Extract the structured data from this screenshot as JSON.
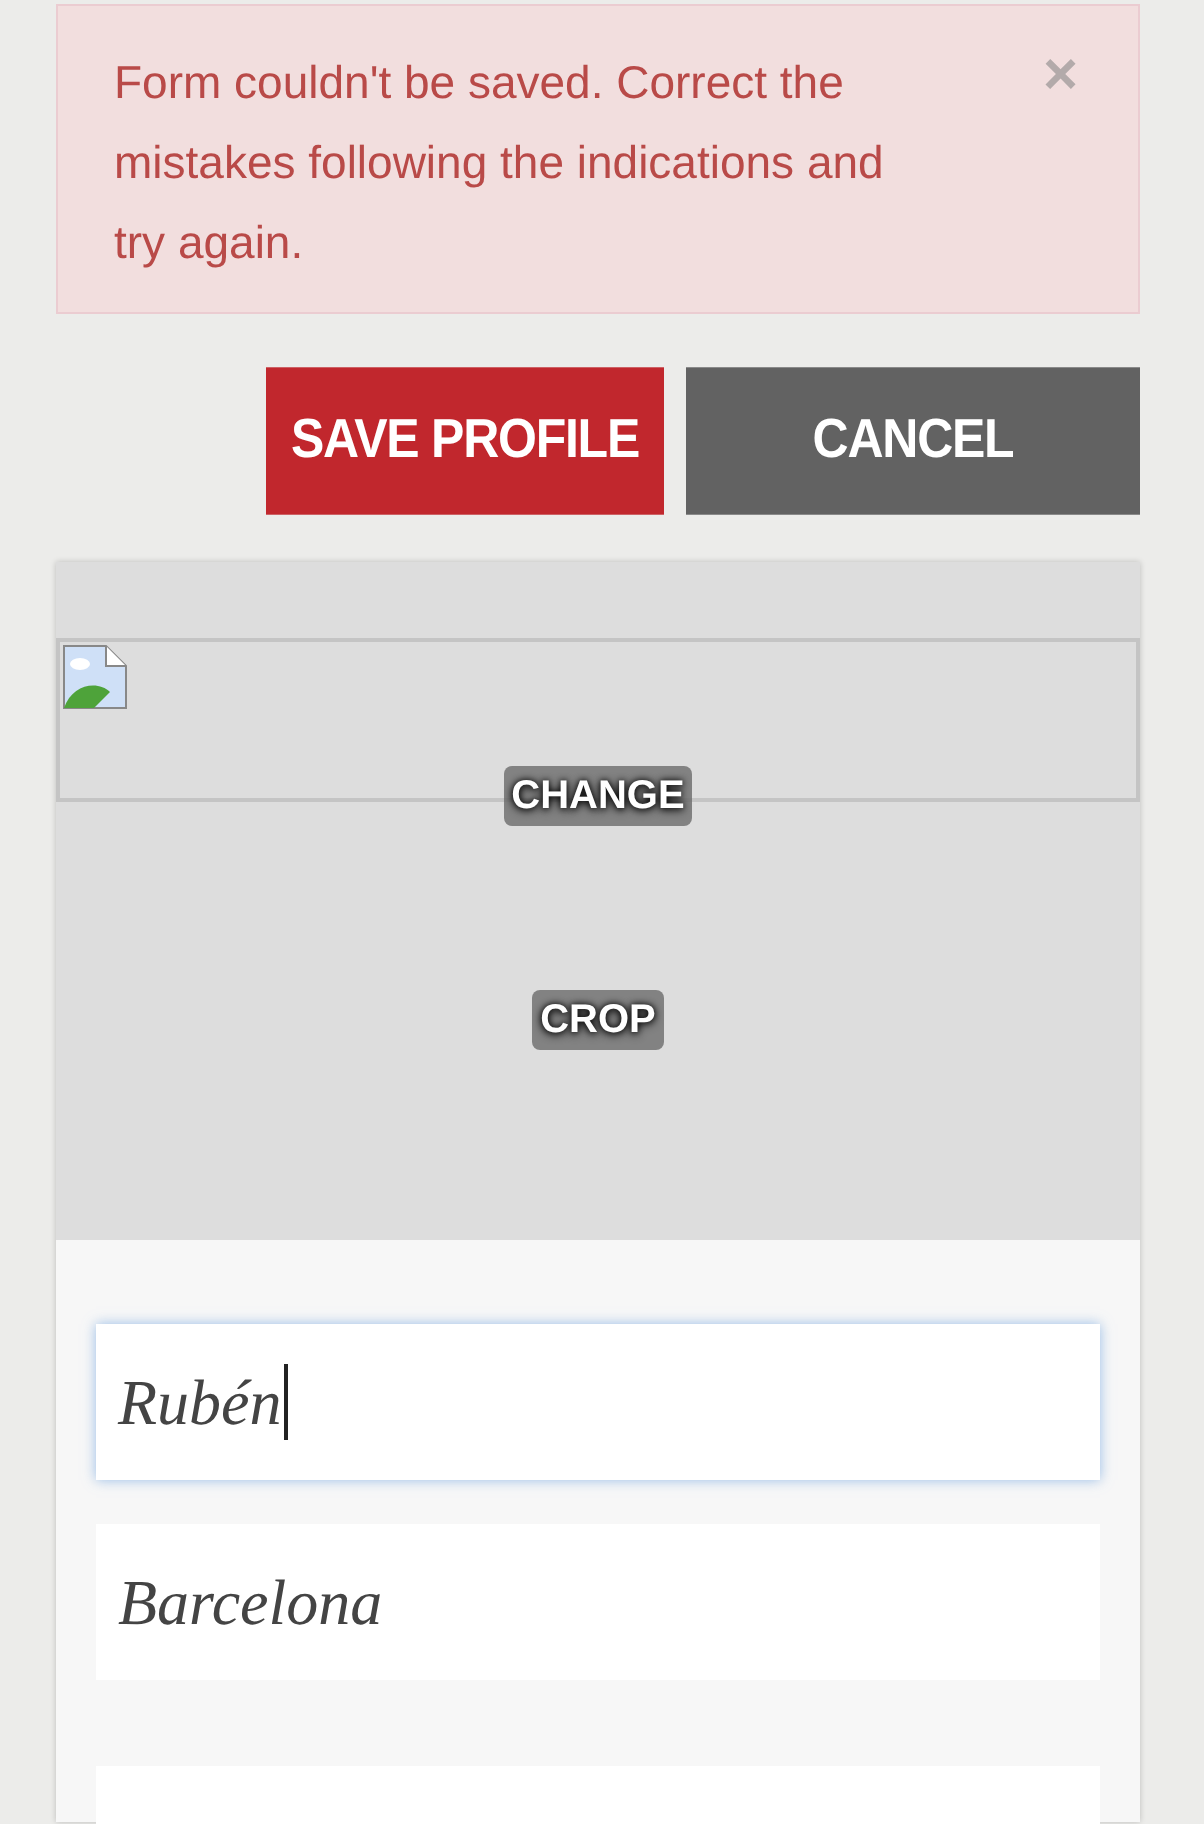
{
  "alert": {
    "message": "Form couldn't be saved. Correct the mistakes following the indications and try again.",
    "close": "×"
  },
  "buttons": [
    {
      "label": "SAVE PROFILE",
      "kind": "primary"
    },
    {
      "label": "CANCEL",
      "kind": "secondary"
    }
  ],
  "photo": {
    "actions": [
      "CHANGE",
      "CROP"
    ]
  },
  "fields": [
    {
      "value": "Rubén",
      "focused": true
    },
    {
      "value": "Barcelona",
      "focused": false
    },
    {
      "focused": false
    }
  ]
}
